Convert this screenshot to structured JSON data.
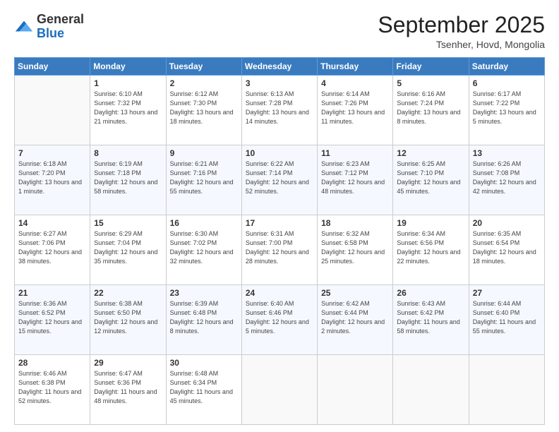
{
  "logo": {
    "general": "General",
    "blue": "Blue"
  },
  "header": {
    "month": "September 2025",
    "location": "Tsenher, Hovd, Mongolia"
  },
  "weekdays": [
    "Sunday",
    "Monday",
    "Tuesday",
    "Wednesday",
    "Thursday",
    "Friday",
    "Saturday"
  ],
  "weeks": [
    [
      {
        "day": "",
        "sunrise": "",
        "sunset": "",
        "daylight": ""
      },
      {
        "day": "1",
        "sunrise": "6:10 AM",
        "sunset": "7:32 PM",
        "daylight": "13 hours and 21 minutes."
      },
      {
        "day": "2",
        "sunrise": "6:12 AM",
        "sunset": "7:30 PM",
        "daylight": "13 hours and 18 minutes."
      },
      {
        "day": "3",
        "sunrise": "6:13 AM",
        "sunset": "7:28 PM",
        "daylight": "13 hours and 14 minutes."
      },
      {
        "day": "4",
        "sunrise": "6:14 AM",
        "sunset": "7:26 PM",
        "daylight": "13 hours and 11 minutes."
      },
      {
        "day": "5",
        "sunrise": "6:16 AM",
        "sunset": "7:24 PM",
        "daylight": "13 hours and 8 minutes."
      },
      {
        "day": "6",
        "sunrise": "6:17 AM",
        "sunset": "7:22 PM",
        "daylight": "13 hours and 5 minutes."
      }
    ],
    [
      {
        "day": "7",
        "sunrise": "6:18 AM",
        "sunset": "7:20 PM",
        "daylight": "13 hours and 1 minute."
      },
      {
        "day": "8",
        "sunrise": "6:19 AM",
        "sunset": "7:18 PM",
        "daylight": "12 hours and 58 minutes."
      },
      {
        "day": "9",
        "sunrise": "6:21 AM",
        "sunset": "7:16 PM",
        "daylight": "12 hours and 55 minutes."
      },
      {
        "day": "10",
        "sunrise": "6:22 AM",
        "sunset": "7:14 PM",
        "daylight": "12 hours and 52 minutes."
      },
      {
        "day": "11",
        "sunrise": "6:23 AM",
        "sunset": "7:12 PM",
        "daylight": "12 hours and 48 minutes."
      },
      {
        "day": "12",
        "sunrise": "6:25 AM",
        "sunset": "7:10 PM",
        "daylight": "12 hours and 45 minutes."
      },
      {
        "day": "13",
        "sunrise": "6:26 AM",
        "sunset": "7:08 PM",
        "daylight": "12 hours and 42 minutes."
      }
    ],
    [
      {
        "day": "14",
        "sunrise": "6:27 AM",
        "sunset": "7:06 PM",
        "daylight": "12 hours and 38 minutes."
      },
      {
        "day": "15",
        "sunrise": "6:29 AM",
        "sunset": "7:04 PM",
        "daylight": "12 hours and 35 minutes."
      },
      {
        "day": "16",
        "sunrise": "6:30 AM",
        "sunset": "7:02 PM",
        "daylight": "12 hours and 32 minutes."
      },
      {
        "day": "17",
        "sunrise": "6:31 AM",
        "sunset": "7:00 PM",
        "daylight": "12 hours and 28 minutes."
      },
      {
        "day": "18",
        "sunrise": "6:32 AM",
        "sunset": "6:58 PM",
        "daylight": "12 hours and 25 minutes."
      },
      {
        "day": "19",
        "sunrise": "6:34 AM",
        "sunset": "6:56 PM",
        "daylight": "12 hours and 22 minutes."
      },
      {
        "day": "20",
        "sunrise": "6:35 AM",
        "sunset": "6:54 PM",
        "daylight": "12 hours and 18 minutes."
      }
    ],
    [
      {
        "day": "21",
        "sunrise": "6:36 AM",
        "sunset": "6:52 PM",
        "daylight": "12 hours and 15 minutes."
      },
      {
        "day": "22",
        "sunrise": "6:38 AM",
        "sunset": "6:50 PM",
        "daylight": "12 hours and 12 minutes."
      },
      {
        "day": "23",
        "sunrise": "6:39 AM",
        "sunset": "6:48 PM",
        "daylight": "12 hours and 8 minutes."
      },
      {
        "day": "24",
        "sunrise": "6:40 AM",
        "sunset": "6:46 PM",
        "daylight": "12 hours and 5 minutes."
      },
      {
        "day": "25",
        "sunrise": "6:42 AM",
        "sunset": "6:44 PM",
        "daylight": "12 hours and 2 minutes."
      },
      {
        "day": "26",
        "sunrise": "6:43 AM",
        "sunset": "6:42 PM",
        "daylight": "11 hours and 58 minutes."
      },
      {
        "day": "27",
        "sunrise": "6:44 AM",
        "sunset": "6:40 PM",
        "daylight": "11 hours and 55 minutes."
      }
    ],
    [
      {
        "day": "28",
        "sunrise": "6:46 AM",
        "sunset": "6:38 PM",
        "daylight": "11 hours and 52 minutes."
      },
      {
        "day": "29",
        "sunrise": "6:47 AM",
        "sunset": "6:36 PM",
        "daylight": "11 hours and 48 minutes."
      },
      {
        "day": "30",
        "sunrise": "6:48 AM",
        "sunset": "6:34 PM",
        "daylight": "11 hours and 45 minutes."
      },
      {
        "day": "",
        "sunrise": "",
        "sunset": "",
        "daylight": ""
      },
      {
        "day": "",
        "sunrise": "",
        "sunset": "",
        "daylight": ""
      },
      {
        "day": "",
        "sunrise": "",
        "sunset": "",
        "daylight": ""
      },
      {
        "day": "",
        "sunrise": "",
        "sunset": "",
        "daylight": ""
      }
    ]
  ],
  "labels": {
    "sunrise": "Sunrise:",
    "sunset": "Sunset:",
    "daylight": "Daylight:"
  }
}
